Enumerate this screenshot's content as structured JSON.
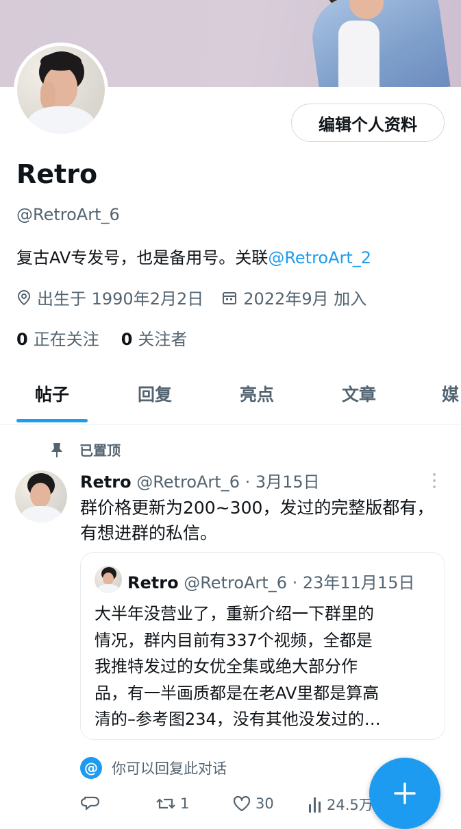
{
  "profile": {
    "edit_button": "编辑个人资料",
    "name": "Retro",
    "handle": "@RetroArt_6",
    "bio_text": "复古AV专发号，也是备用号。关联",
    "bio_link": "@RetroArt_2",
    "birth": "出生于 1990年2月2日",
    "joined": "2022年9月 加入",
    "following_count": "0",
    "following_label": "正在关注",
    "followers_count": "0",
    "followers_label": "关注者"
  },
  "tabs": [
    {
      "label": "帖子",
      "active": true
    },
    {
      "label": "回复",
      "active": false
    },
    {
      "label": "亮点",
      "active": false
    },
    {
      "label": "文章",
      "active": false
    },
    {
      "label": "媒",
      "active": false
    }
  ],
  "tweet": {
    "pinned_label": "已置顶",
    "name": "Retro",
    "meta": "@RetroArt_6 · 3月15日",
    "text": "群价格更新为200~300，发过的完整版都有，有想进群的私信。",
    "quote": {
      "name": "Retro",
      "meta": "@RetroArt_6 · 23年11月15日",
      "text": "大半年没营业了，重新介绍一下群里的\n情况，群内目前有337个视频，全都是\n我推特发过的女优全集或绝大部分作\n品，有一半画质都是在老AV里都是算高\n清的–参考图234，没有其他没发过的…"
    },
    "reply_note": "你可以回复此对话",
    "reply_badge": "@",
    "actions": {
      "reply_count": "",
      "retweet_count": "1",
      "like_count": "30",
      "views_count": "24.5万"
    }
  },
  "colors": {
    "accent": "#1d9bf0",
    "text": "#0f1419",
    "secondary": "#536471",
    "border": "#e6ecf0"
  },
  "icons": [
    "location-icon",
    "calendar-icon",
    "pin-icon",
    "more-icon",
    "reply-icon",
    "retweet-icon",
    "like-icon",
    "views-icon",
    "plus-icon"
  ]
}
